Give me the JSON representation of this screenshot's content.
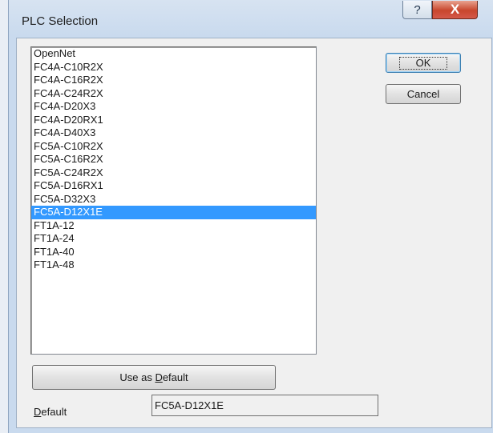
{
  "window": {
    "title": "PLC Selection",
    "help_glyph": "?",
    "close_glyph": "X"
  },
  "plc_list": {
    "selected_index": 12,
    "items": [
      "OpenNet",
      "FC4A-C10R2X",
      "FC4A-C16R2X",
      "FC4A-C24R2X",
      "FC4A-D20X3",
      "FC4A-D20RX1",
      "FC4A-D40X3",
      "FC5A-C10R2X",
      "FC5A-C16R2X",
      "FC5A-C24R2X",
      "FC5A-D16RX1",
      "FC5A-D32X3",
      "FC5A-D12X1E",
      "FT1A-12",
      "FT1A-24",
      "FT1A-40",
      "FT1A-48"
    ]
  },
  "buttons": {
    "ok": "OK",
    "cancel": "Cancel",
    "use_as_default_prefix": "Use as ",
    "use_as_default_mnemonic": "D",
    "use_as_default_suffix": "efault"
  },
  "default": {
    "label_mnemonic": "D",
    "label_suffix": "efault",
    "value": "FC5A-D12X1E"
  },
  "colors": {
    "selection": "#3399ff",
    "close_button": "#c8462d"
  }
}
